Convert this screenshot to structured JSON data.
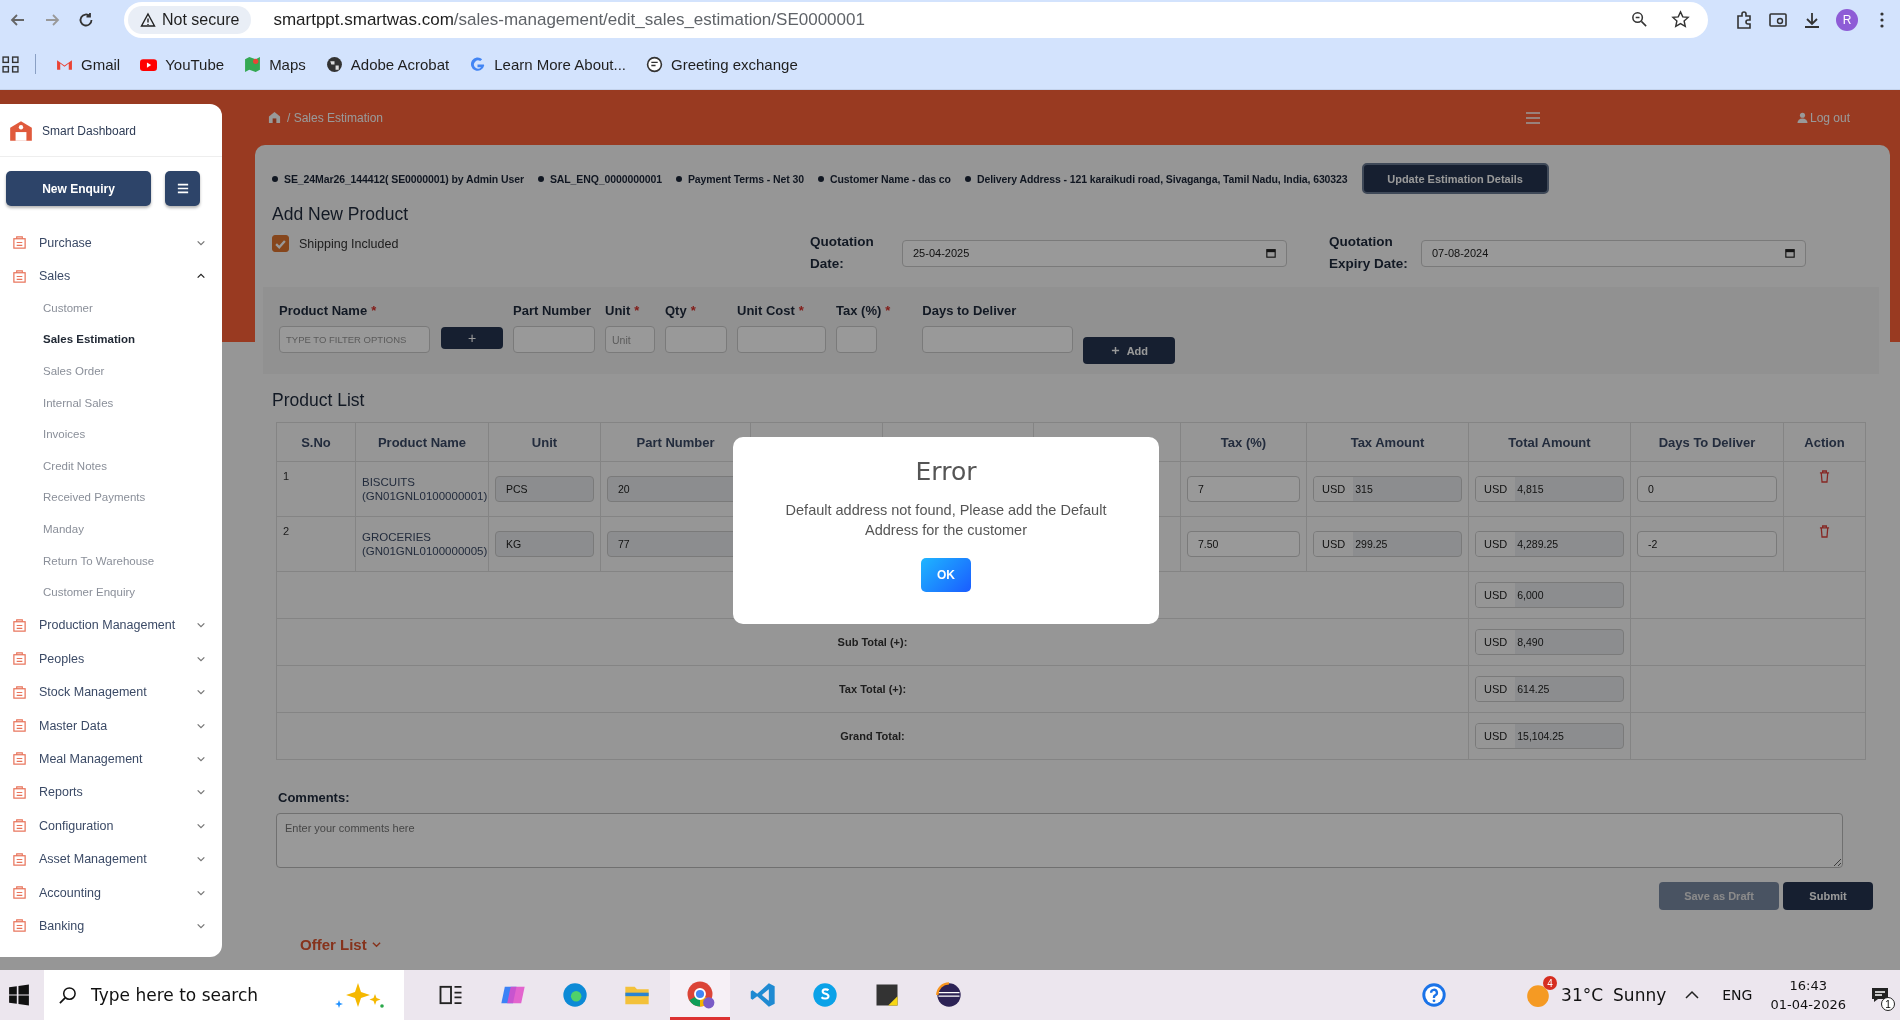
{
  "browser": {
    "security_chip": "Not secure",
    "url_host": "smartppt.smartwas.com",
    "url_path": "/sales-management/edit_sales_estimation/SE0000001",
    "profile_initial": "R"
  },
  "bookmarks": [
    {
      "label": "Gmail",
      "kind": "gmail"
    },
    {
      "label": "YouTube",
      "kind": "youtube"
    },
    {
      "label": "Maps",
      "kind": "maps"
    },
    {
      "label": "Adobe Acrobat",
      "kind": "globe"
    },
    {
      "label": "Learn More About...",
      "kind": "google"
    },
    {
      "label": "Greeting exchange",
      "kind": "chat"
    }
  ],
  "sidebar": {
    "brand": "Smart Dashboard",
    "new_enquiry_button": "New Enquiry",
    "items": [
      {
        "label": "Purchase",
        "expanded": false
      },
      {
        "label": "Sales",
        "expanded": true,
        "children": [
          {
            "label": "Customer",
            "selected": false
          },
          {
            "label": "Sales Estimation",
            "selected": true
          },
          {
            "label": "Sales Order",
            "selected": false
          },
          {
            "label": "Internal Sales",
            "selected": false
          },
          {
            "label": "Invoices",
            "selected": false
          },
          {
            "label": "Credit Notes",
            "selected": false
          },
          {
            "label": "Received Payments",
            "selected": false
          },
          {
            "label": "Manday",
            "selected": false
          },
          {
            "label": "Return To Warehouse",
            "selected": false
          },
          {
            "label": "Customer Enquiry",
            "selected": false
          }
        ]
      },
      {
        "label": "Production Management",
        "expanded": false
      },
      {
        "label": "Peoples",
        "expanded": false
      },
      {
        "label": "Stock Management",
        "expanded": false
      },
      {
        "label": "Master Data",
        "expanded": false
      },
      {
        "label": "Meal Management",
        "expanded": false
      },
      {
        "label": "Reports",
        "expanded": false
      },
      {
        "label": "Configuration",
        "expanded": false
      },
      {
        "label": "Asset Management",
        "expanded": false
      },
      {
        "label": "Accounting",
        "expanded": false
      },
      {
        "label": "Banking",
        "expanded": false
      }
    ]
  },
  "header": {
    "breadcrumb": "/ Sales Estimation",
    "logout": "Log out"
  },
  "info": [
    "SE_24Mar26_144412( SE0000001) by Admin User",
    "SAL_ENQ_0000000001",
    "Payment Terms - Net 30",
    "Customer Name - das co",
    "Delivery Address - 121 karaikudi road, Sivaganga, Tamil Nadu, India, 630323"
  ],
  "update_button": "Update Estimation Details",
  "form": {
    "title": "Add New Product",
    "shipping": {
      "label": "Shipping Included",
      "checked": true
    },
    "quotation_date": {
      "label": "Quotation Date:",
      "value": "25-04-2025"
    },
    "expiry_date": {
      "label": "Quotation Expiry Date:",
      "value": "07-08-2024"
    },
    "fields": [
      {
        "label": "Product Name",
        "required_mark": "*",
        "placeholder": "TYPE TO FILTER OPTIONS"
      },
      {
        "label": "Part Number"
      },
      {
        "label": "Unit",
        "required_mark": "*",
        "placeholder": "Unit"
      },
      {
        "label": "Qty",
        "required_mark": "*"
      },
      {
        "label": "Unit Cost",
        "required_mark": "*"
      },
      {
        "label": "Tax (%)",
        "required_mark": "*"
      },
      {
        "label": "Days to Deliver"
      }
    ],
    "plus_button": "+",
    "add_button": "Add"
  },
  "product_list": {
    "title": "Product List",
    "columns": [
      "S.No",
      "Product Name",
      "Unit",
      "Part Number",
      "Tax (%)",
      "Tax Amount",
      "Total Amount",
      "Days To Deliver",
      "Action"
    ],
    "rows": [
      {
        "sno": "1",
        "product": "BISCUITS (GN01GNL0100000001)",
        "unit": "PCS",
        "part_number": "20",
        "tax": "7",
        "tax_currency": "USD",
        "tax_amount": "315",
        "total_currency": "USD",
        "total_amount": "4,815",
        "days": "0"
      },
      {
        "sno": "2",
        "product": "GROCERIES (GN01GNL0100000005)",
        "unit": "KG",
        "part_number": "77",
        "tax": "7.50",
        "tax_currency": "USD",
        "tax_amount": "299.25",
        "total_currency": "USD",
        "total_amount": "4,289.25",
        "days": "-2"
      }
    ],
    "totals": [
      {
        "currency": "USD",
        "value": "6,000"
      },
      {
        "label": "Sub Total (+):",
        "currency": "USD",
        "value": "8,490"
      },
      {
        "label": "Tax Total (+):",
        "currency": "USD",
        "value": "614.25"
      },
      {
        "label": "Grand Total:",
        "currency": "USD",
        "value": "15,104.25"
      }
    ]
  },
  "comments": {
    "label": "Comments:",
    "placeholder": "Enter your comments here"
  },
  "save_draft_button": "Save as Draft",
  "submit_button": "Submit",
  "offer_list": "Offer List",
  "modal": {
    "title": "Error",
    "message": "Default address not found, Please add the Default Address for the customer",
    "ok_button": "OK"
  },
  "taskbar": {
    "search_placeholder": "Type here to search",
    "weather_badge": "4",
    "temperature": "31°C",
    "condition": "Sunny",
    "language": "ENG",
    "time": "16:43",
    "date": "01-04-2026",
    "notification_count": "1"
  }
}
